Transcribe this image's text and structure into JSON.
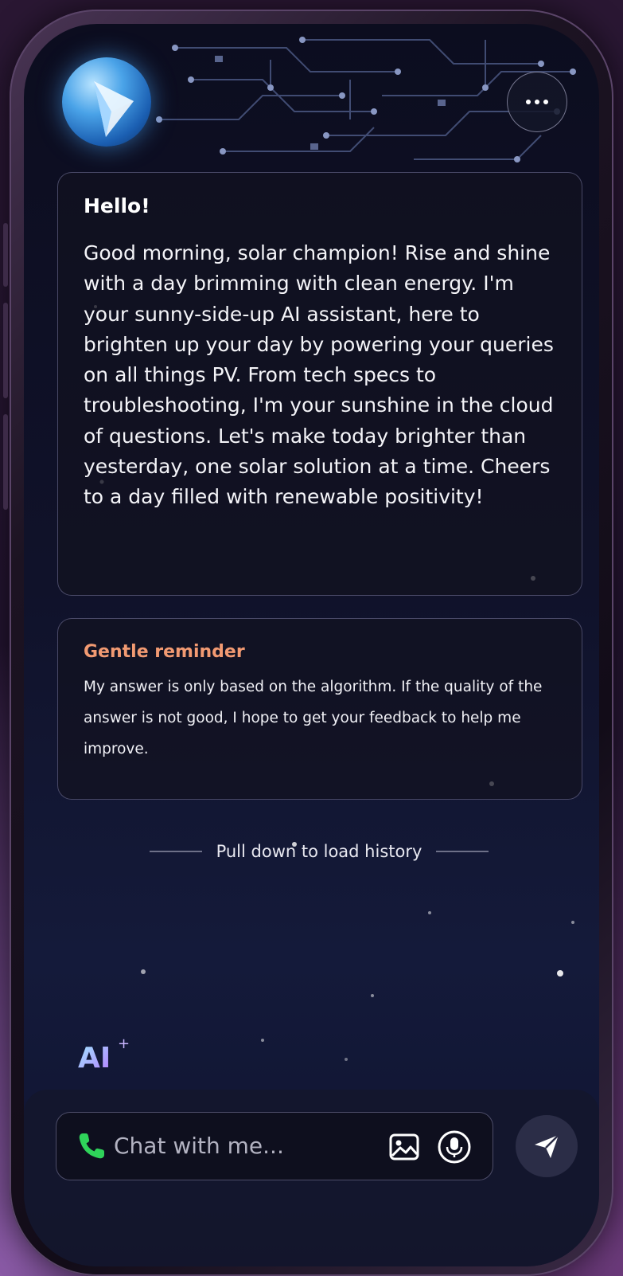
{
  "header": {
    "avatar": "assistant-globe-avatar",
    "more_icon": "more-horizontal-icon"
  },
  "greeting": {
    "title": "Hello!",
    "body": "Good morning, solar champion! Rise and shine with a day brimming with clean energy. I'm your sunny-side-up AI assistant, here to brighten up your day by powering your queries on all things PV. From tech specs to troubleshooting, I'm your sunshine in the cloud of questions. Let's make today brighter than yesterday, one solar solution at a time. Cheers to a day filled with renewable positivity!"
  },
  "reminder": {
    "title": "Gentle reminder",
    "body": "My answer is only based on the algorithm. If the quality of the answer is not good, I hope to get your feedback to help me improve."
  },
  "history_hint": "Pull down to load history",
  "ai_badge": {
    "label": "AI",
    "plus": "+"
  },
  "composer": {
    "placeholder": "Chat with me...",
    "left_icon": "phone-icon",
    "right_icons": [
      "image-icon",
      "microphone-icon"
    ],
    "send_icon": "send-icon"
  },
  "colors": {
    "reminder_title": "#f29a72",
    "phone_icon": "#2fd35a",
    "card_border": "#787aa0"
  }
}
